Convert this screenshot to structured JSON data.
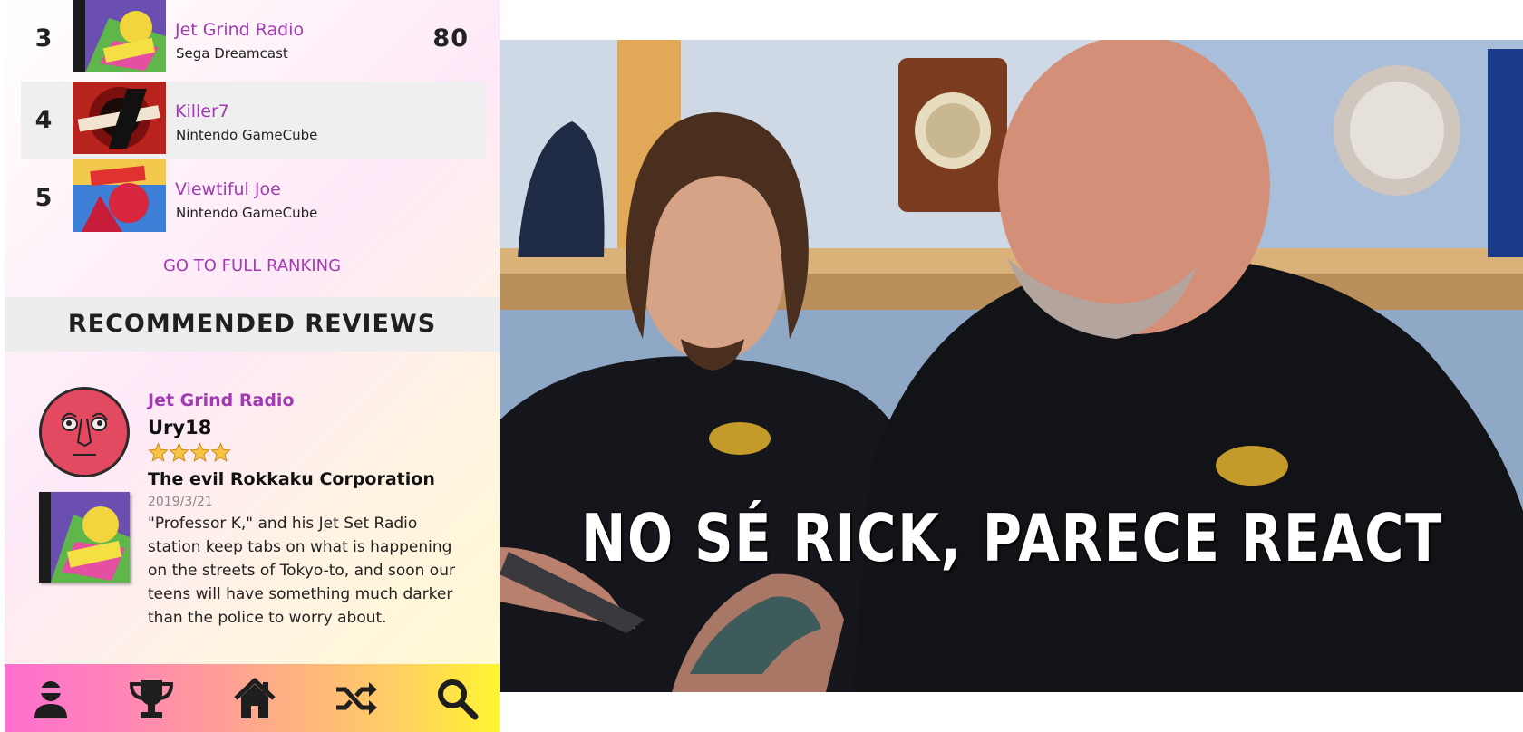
{
  "ranking": {
    "rows": [
      {
        "rank": "3",
        "title": "Jet Grind Radio",
        "platform": "Sega Dreamcast",
        "score": "80"
      },
      {
        "rank": "4",
        "title": "Killer7",
        "platform": "Nintendo GameCube",
        "score": ""
      },
      {
        "rank": "5",
        "title": "Viewtiful Joe",
        "platform": "Nintendo GameCube",
        "score": ""
      }
    ],
    "full_ranking_link": "GO TO FULL RANKING"
  },
  "reviews": {
    "section_title": "RECOMMENDED REVIEWS",
    "item": {
      "game": "Jet Grind Radio",
      "user": "Ury18",
      "stars": 4,
      "headline": "The evil Rokkaku Corporation",
      "date": "2019/3/21",
      "body": "\"Professor K,\" and his Jet Set Radio station keep tabs on what is happening on the streets of Tokyo-to, and soon our teens will have something much darker than the police to worry about."
    }
  },
  "nav": {
    "items": [
      "profile-icon",
      "trophy-icon",
      "home-icon",
      "shuffle-icon",
      "search-icon"
    ]
  },
  "meme": {
    "caption": "NO SÉ RICK, PARECE REACT"
  },
  "colors": {
    "accent_purple": "#a23bb1",
    "star": "#f6c244",
    "avatar": "#e34960"
  }
}
